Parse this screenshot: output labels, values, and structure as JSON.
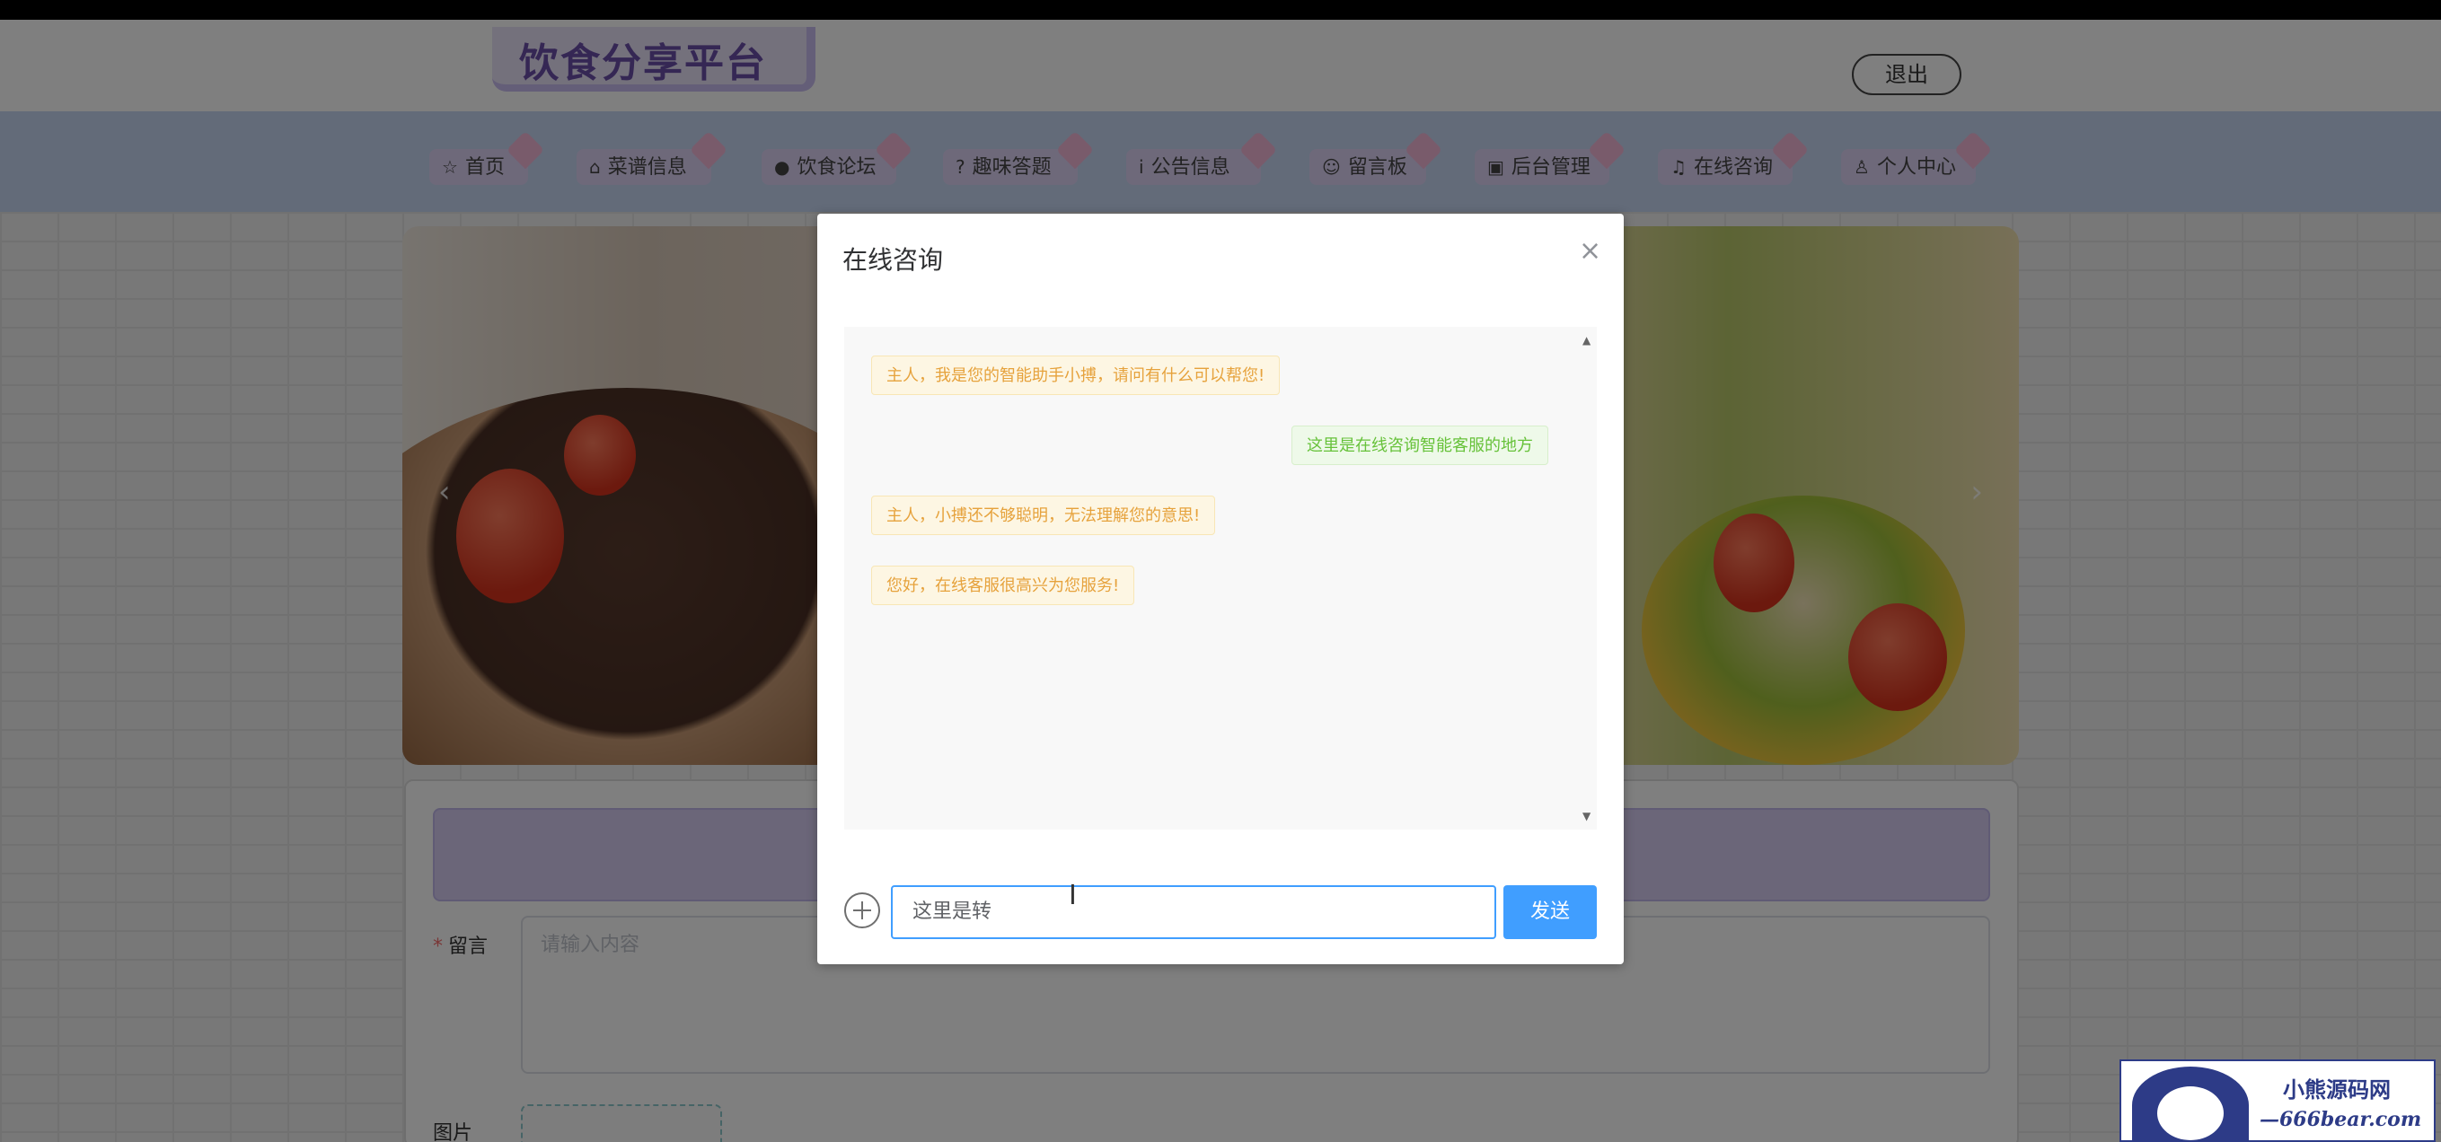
{
  "app": {
    "title": "饮食分享平台",
    "logout_label": "退出"
  },
  "nav": {
    "items": [
      {
        "icon": "star-icon",
        "glyph": "☆",
        "label": "首页"
      },
      {
        "icon": "bag-icon",
        "glyph": "⌂",
        "label": "菜谱信息"
      },
      {
        "icon": "info-icon",
        "glyph": "●",
        "label": "饮食论坛"
      },
      {
        "icon": "question-icon",
        "glyph": "?",
        "label": "趣味答题"
      },
      {
        "icon": "info-icon",
        "glyph": "i",
        "label": "公告信息"
      },
      {
        "icon": "smile-icon",
        "glyph": "☺",
        "label": "留言板"
      },
      {
        "icon": "briefcase-icon",
        "glyph": "▣",
        "label": "后台管理"
      },
      {
        "icon": "headset-icon",
        "glyph": "♫",
        "label": "在线咨询"
      },
      {
        "icon": "user-icon",
        "glyph": "♙",
        "label": "个人中心"
      }
    ]
  },
  "banner": {
    "prev_glyph": "‹",
    "next_glyph": "›"
  },
  "message_form": {
    "message_label": "留言",
    "message_placeholder": "请输入内容",
    "image_label": "图片"
  },
  "dialog": {
    "title": "在线咨询",
    "close_glyph": "×",
    "messages": [
      {
        "side": "left",
        "text": "主人，我是您的智能助手小搏，请问有什么可以帮您!"
      },
      {
        "side": "right",
        "text": "这里是在线咨询智能客服的地方"
      },
      {
        "side": "left",
        "text": "主人，小搏还不够聪明，无法理解您的意思!"
      },
      {
        "side": "left",
        "text": "您好，在线客服很高兴为您服务!"
      }
    ],
    "input_value": "这里是转",
    "send_label": "发送"
  },
  "watermark": {
    "line1": "小熊源码网",
    "line2": "—666bear.com—"
  },
  "colors": {
    "primary": "#409eff",
    "bubble_left_text": "#e6a23c",
    "bubble_right_text": "#67c23a",
    "nav_bg": "#c7d6f3",
    "nav_item_bg": "#dcd2f5"
  }
}
